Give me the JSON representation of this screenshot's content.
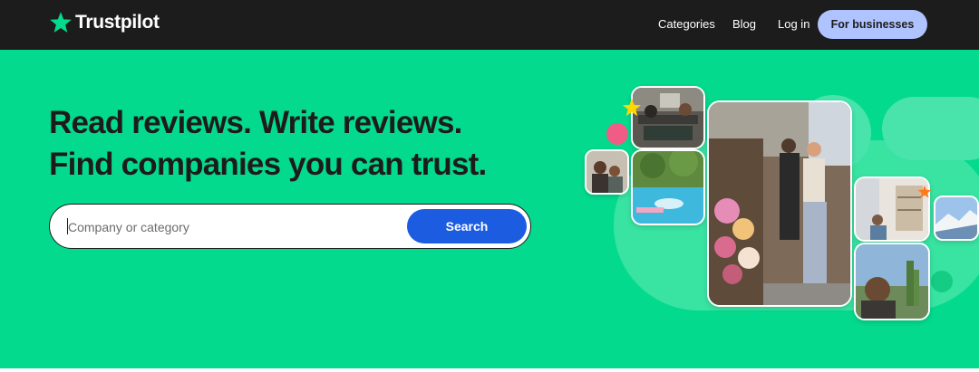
{
  "header": {
    "logo_text": "Trustpilot",
    "nav": {
      "categories": "Categories",
      "blog": "Blog",
      "login": "Log in",
      "for_businesses": "For businesses"
    }
  },
  "hero": {
    "headline_line1": "Read reviews. Write reviews.",
    "headline_line2": "Find companies you can trust."
  },
  "search": {
    "placeholder": "Company or category",
    "button_label": "Search"
  },
  "colors": {
    "brand_green": "#04da8d",
    "topbar": "#1c1c1c",
    "search_button": "#1c5ce1",
    "business_button": "#afc3ff",
    "star_yellow": "#ffd700",
    "star_orange": "#ff7a1a",
    "dot_pink": "#ef5c86"
  },
  "icons": {
    "logo": "trustpilot-star-icon",
    "collage_star_1": "star-icon",
    "collage_star_2": "star-icon"
  }
}
